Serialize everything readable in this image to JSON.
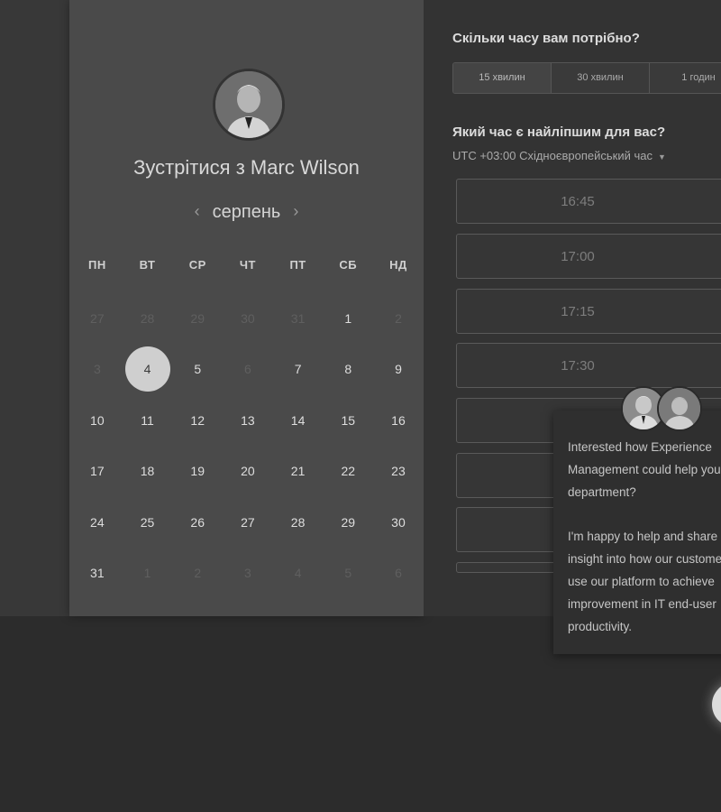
{
  "booking": {
    "title_prefix": "Зустрітися з",
    "host_name": "Marc Wilson",
    "month": "серпень",
    "prev_arrow": "‹",
    "next_arrow": "›",
    "weekdays": [
      "ПН",
      "ВТ",
      "СР",
      "ЧТ",
      "ПТ",
      "СБ",
      "НД"
    ],
    "weeks": [
      [
        {
          "d": "27",
          "state": "muted"
        },
        {
          "d": "28",
          "state": "muted"
        },
        {
          "d": "29",
          "state": "muted"
        },
        {
          "d": "30",
          "state": "muted"
        },
        {
          "d": "31",
          "state": "muted"
        },
        {
          "d": "1",
          "state": "available"
        },
        {
          "d": "2",
          "state": "muted"
        }
      ],
      [
        {
          "d": "3",
          "state": "muted"
        },
        {
          "d": "4",
          "state": "selected"
        },
        {
          "d": "5",
          "state": "available"
        },
        {
          "d": "6",
          "state": "muted"
        },
        {
          "d": "7",
          "state": "available"
        },
        {
          "d": "8",
          "state": "available"
        },
        {
          "d": "9",
          "state": "available"
        }
      ],
      [
        {
          "d": "10",
          "state": "available"
        },
        {
          "d": "11",
          "state": "available"
        },
        {
          "d": "12",
          "state": "available"
        },
        {
          "d": "13",
          "state": "available"
        },
        {
          "d": "14",
          "state": "available"
        },
        {
          "d": "15",
          "state": "available"
        },
        {
          "d": "16",
          "state": "available"
        }
      ],
      [
        {
          "d": "17",
          "state": "available"
        },
        {
          "d": "18",
          "state": "available"
        },
        {
          "d": "19",
          "state": "available"
        },
        {
          "d": "20",
          "state": "available"
        },
        {
          "d": "21",
          "state": "available"
        },
        {
          "d": "22",
          "state": "available"
        },
        {
          "d": "23",
          "state": "available"
        }
      ],
      [
        {
          "d": "24",
          "state": "available"
        },
        {
          "d": "25",
          "state": "available"
        },
        {
          "d": "26",
          "state": "available"
        },
        {
          "d": "27",
          "state": "available"
        },
        {
          "d": "28",
          "state": "available"
        },
        {
          "d": "29",
          "state": "available"
        },
        {
          "d": "30",
          "state": "available"
        }
      ],
      [
        {
          "d": "31",
          "state": "available"
        },
        {
          "d": "1",
          "state": "muted"
        },
        {
          "d": "2",
          "state": "muted"
        },
        {
          "d": "3",
          "state": "muted"
        },
        {
          "d": "4",
          "state": "muted"
        },
        {
          "d": "5",
          "state": "muted"
        },
        {
          "d": "6",
          "state": "muted"
        }
      ]
    ]
  },
  "schedule": {
    "duration_question": "Скільки часу вам потрібно?",
    "durations": [
      "15 хвилин",
      "30 хвилин",
      "1 годин"
    ],
    "time_question": "Який час є найліпшим для вас?",
    "timezone": "UTC +03:00 Східноєвропейський час",
    "slots": [
      "16:45",
      "17:00",
      "17:15",
      "17:30",
      "",
      "",
      ""
    ]
  },
  "chat": {
    "message_1": [
      "Interested how Experience",
      "Management could help your",
      "department?"
    ],
    "message_2": [
      "I'm happy to help and share",
      "insight into how our customers",
      "use our platform to achieve",
      "improvement in IT end-user",
      "productivity."
    ]
  },
  "colors": {
    "selected_day": "#cfcfcf",
    "panel": "#4a4a4a",
    "right_panel": "#333333"
  }
}
